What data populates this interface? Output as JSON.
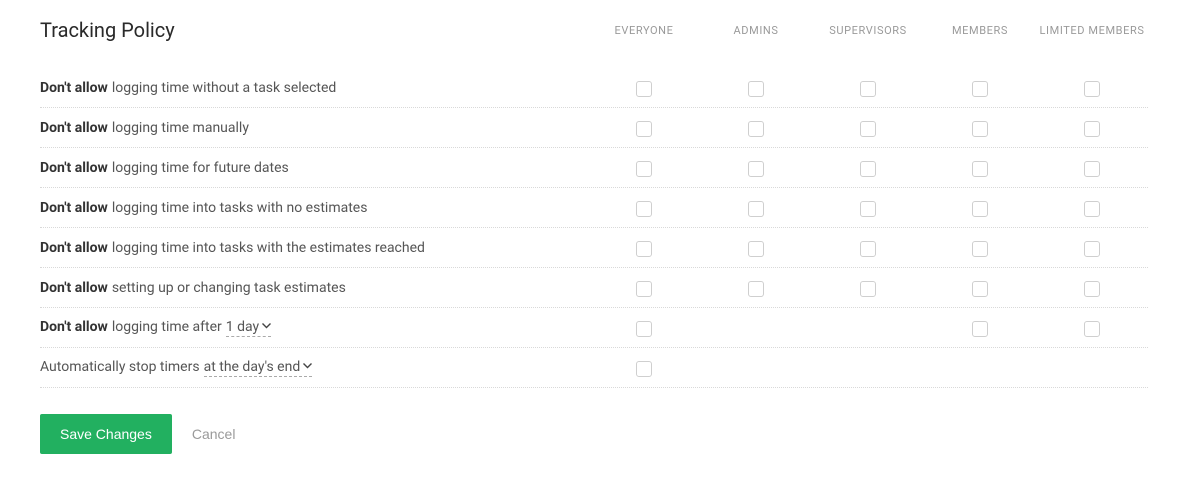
{
  "title": "Tracking Policy",
  "columns": [
    "EVERYONE",
    "ADMINS",
    "SUPERVISORS",
    "MEMBERS",
    "LIMITED MEMBERS"
  ],
  "rules": [
    {
      "prefix": "Don't allow",
      "main": "logging time without a task selected",
      "available": [
        true,
        true,
        true,
        true,
        true
      ]
    },
    {
      "prefix": "Don't allow",
      "main": "logging time manually",
      "available": [
        true,
        true,
        true,
        true,
        true
      ]
    },
    {
      "prefix": "Don't allow",
      "main": "logging time for future dates",
      "available": [
        true,
        true,
        true,
        true,
        true
      ]
    },
    {
      "prefix": "Don't allow",
      "main": "logging time into tasks with no estimates",
      "available": [
        true,
        true,
        true,
        true,
        true
      ]
    },
    {
      "prefix": "Don't allow",
      "main": "logging time into tasks with the estimates reached",
      "available": [
        true,
        true,
        true,
        true,
        true
      ]
    },
    {
      "prefix": "Don't allow",
      "main": "setting up or changing task estimates",
      "available": [
        true,
        true,
        true,
        true,
        true
      ]
    },
    {
      "prefix": "Don't allow",
      "main": "logging time after",
      "select": "1 day",
      "available": [
        true,
        false,
        false,
        true,
        true
      ]
    },
    {
      "prefix": "",
      "main": "Automatically stop timers",
      "select": "at the day's end",
      "available": [
        true,
        false,
        false,
        false,
        false
      ]
    }
  ],
  "actions": {
    "save": "Save Changes",
    "cancel": "Cancel"
  }
}
